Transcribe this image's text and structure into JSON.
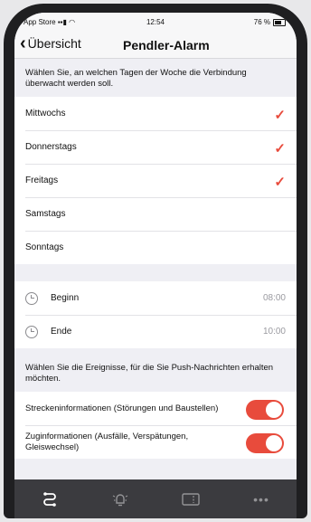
{
  "status_bar": {
    "carrier": "App Store",
    "time": "12:54",
    "battery": "76 %"
  },
  "nav": {
    "back_label": "Übersicht",
    "title": "Pendler-Alarm"
  },
  "days_section": {
    "header": "Wählen Sie, an welchen Tagen der Woche die Verbindung überwacht werden soll.",
    "days": [
      {
        "label": "Mittwochs",
        "checked": true
      },
      {
        "label": "Donnerstags",
        "checked": true
      },
      {
        "label": "Freitags",
        "checked": true
      },
      {
        "label": "Samstags",
        "checked": false
      },
      {
        "label": "Sonntags",
        "checked": false
      }
    ]
  },
  "time_section": {
    "begin_label": "Beginn",
    "begin_time": "08:00",
    "end_label": "Ende",
    "end_time": "10:00"
  },
  "events_section": {
    "header": "Wählen Sie die Ereignisse, für die Sie Push-Nachrichten erhalten möchten.",
    "items": [
      {
        "label": "Streckeninformationen (Störungen und Baustellen)",
        "on": true
      },
      {
        "label": "Zuginformationen (Ausfälle, Verspätungen, Gleiswechsel)",
        "on": true
      }
    ]
  },
  "colors": {
    "accent": "#e84b3c",
    "tabbar": "#3b3b3f"
  },
  "tabs": [
    "route-icon",
    "alarm-icon",
    "ticket-icon",
    "more-icon"
  ]
}
